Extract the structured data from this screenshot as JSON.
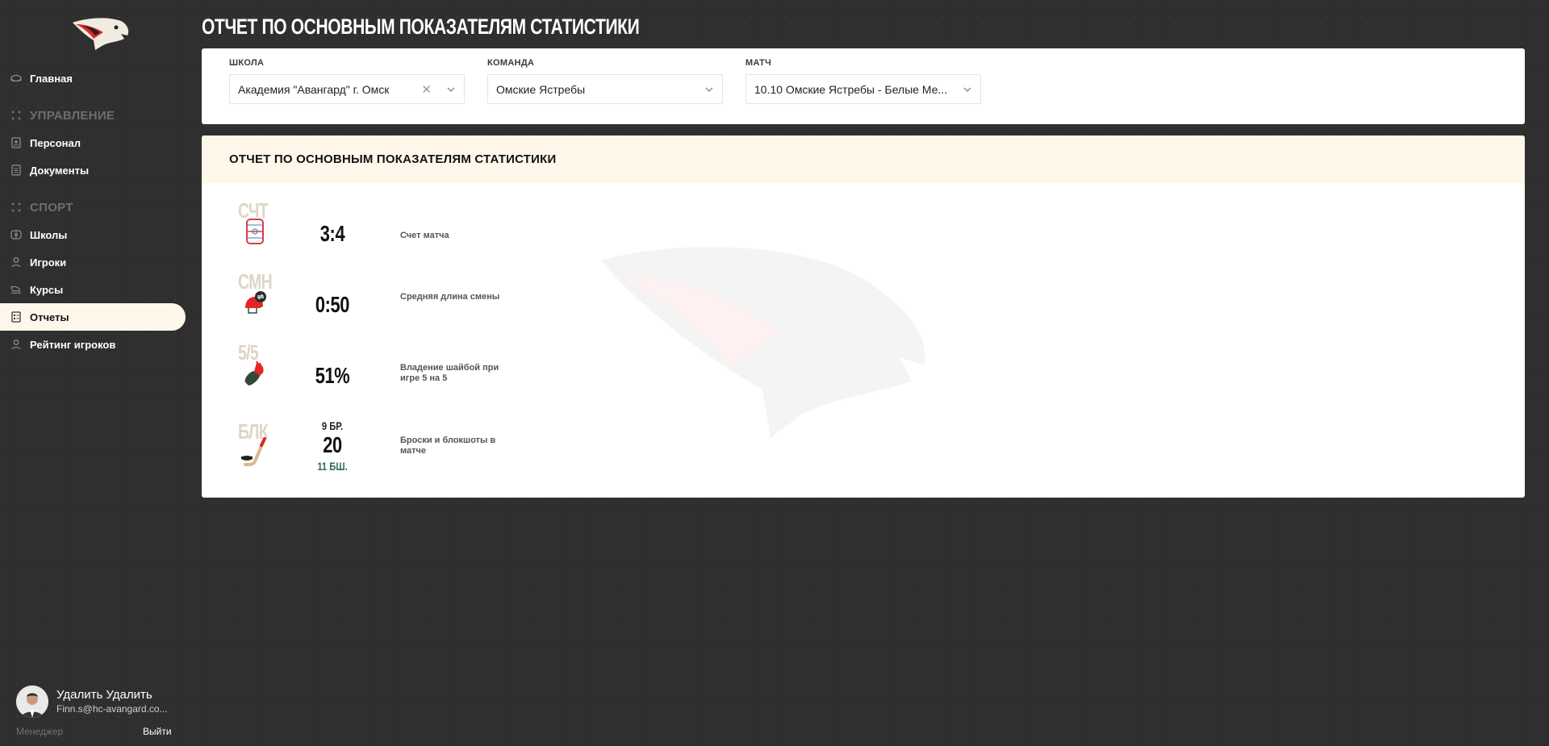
{
  "sidebar": {
    "items": {
      "home": "Главная",
      "section_manage": "УПРАВЛЕНИЕ",
      "staff": "Персонал",
      "documents": "Документы",
      "section_sport": "СПОРТ",
      "schools": "Школы",
      "players": "Игроки",
      "courses": "Курсы",
      "reports": "Отчеты",
      "rating": "Рейтинг игроков"
    },
    "user": {
      "name": "Удалить Удалить",
      "email": "Finn.s@hc-avangard.co...",
      "role": "Менеджер",
      "logout": "Выйти"
    }
  },
  "page": {
    "title": "ОТЧЕТ ПО ОСНОВНЫМ ПОКАЗАТЕЛЯМ СТАТИСТИКИ"
  },
  "filters": {
    "school": {
      "label": "ШКОЛА",
      "value": "Академия \"Авангард\" г. Омск"
    },
    "team": {
      "label": "КОМАНДА",
      "value": "Омские Ястребы"
    },
    "match": {
      "label": "МАТЧ",
      "value": "10.10 Омские Ястребы - Белые Ме..."
    }
  },
  "report": {
    "title": "ОТЧЕТ ПО ОСНОВНЫМ ПОКАЗАТЕЛЯМ СТАТИСТИКИ",
    "stats": [
      {
        "abbr": "СЧТ",
        "value": "3:4",
        "desc": "Счет матча",
        "icon": "hockey-rink-icon"
      },
      {
        "abbr": "СМН",
        "value": "0:50",
        "desc": "Средняя длина смены",
        "icon": "helmet-swap-icon"
      },
      {
        "abbr": "5/5",
        "value": "51%",
        "desc": "Владение шайбой при игре 5 на 5",
        "icon": "glove-icon"
      },
      {
        "abbr": "БЛК",
        "value": "20",
        "top": "9 БР.",
        "bottom": "11 БШ.",
        "desc": "Броски и блокшоты в матче",
        "icon": "stick-puck-icon"
      }
    ]
  },
  "colors": {
    "accent_bg": "#fff8ea",
    "brand_red": "#e32626",
    "bottom_green": "#2f6b4a"
  }
}
